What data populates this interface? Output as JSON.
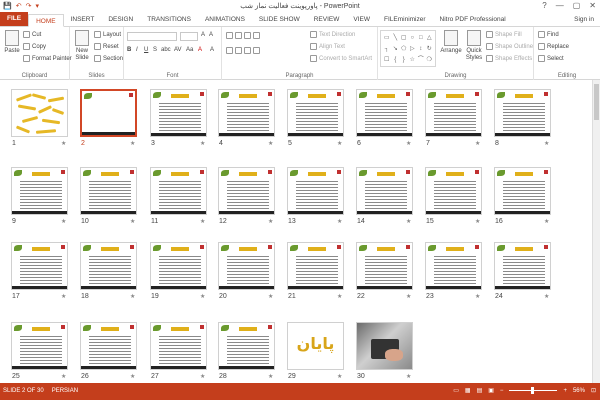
{
  "window": {
    "title": "پاورپوینت فعالیت نماز شب - PowerPoint",
    "controls": [
      "?",
      "—",
      "▢",
      "✕"
    ]
  },
  "quick_access": [
    "💾",
    "↶",
    "↷",
    "▾"
  ],
  "tabs": [
    {
      "label": "FILE"
    },
    {
      "label": "HOME"
    },
    {
      "label": "INSERT"
    },
    {
      "label": "DESIGN"
    },
    {
      "label": "TRANSITIONS"
    },
    {
      "label": "ANIMATIONS"
    },
    {
      "label": "SLIDE SHOW"
    },
    {
      "label": "REVIEW"
    },
    {
      "label": "VIEW"
    },
    {
      "label": "FILEminimizer"
    },
    {
      "label": "Nitro PDF Professional"
    }
  ],
  "signin": "Sign in",
  "ribbon": {
    "clipboard": {
      "paste": "Paste",
      "cut": "Cut",
      "copy": "Copy",
      "format_painter": "Format Painter",
      "label": "Clipboard"
    },
    "slides": {
      "new_slide": "New Slide",
      "layout": "Layout",
      "reset": "Reset",
      "section": "Section",
      "label": "Slides"
    },
    "font": {
      "bold": "B",
      "italic": "I",
      "underline": "U",
      "strike": "S",
      "shadow": "abc",
      "spacing": "AV",
      "case": "Aa",
      "color": "A",
      "grow": "A",
      "shrink": "A",
      "clear": "A",
      "label": "Font"
    },
    "paragraph": {
      "text_direction": "Text Direction",
      "align_text": "Align Text",
      "smartart": "Convert to SmartArt",
      "label": "Paragraph"
    },
    "drawing": {
      "arrange": "Arrange",
      "quick_styles": "Quick Styles",
      "shape_fill": "Shape Fill",
      "shape_outline": "Shape Outline",
      "shape_effects": "Shape Effects",
      "label": "Drawing",
      "shapes": [
        "▭",
        "╲",
        "▢",
        "○",
        "□",
        "△",
        "┐",
        "↘",
        "⬠",
        "▷",
        "↕",
        "↻",
        "☐",
        "{",
        "}",
        "☆",
        "⌒",
        "❍"
      ]
    },
    "editing": {
      "find": "Find",
      "replace": "Replace",
      "select": "Select",
      "label": "Editing"
    }
  },
  "slides": [
    {
      "num": "1",
      "kind": "sticks"
    },
    {
      "num": "2",
      "kind": "blank",
      "selected": true
    },
    {
      "num": "3",
      "kind": "text"
    },
    {
      "num": "4",
      "kind": "text"
    },
    {
      "num": "5",
      "kind": "text"
    },
    {
      "num": "6",
      "kind": "text"
    },
    {
      "num": "7",
      "kind": "text"
    },
    {
      "num": "8",
      "kind": "text"
    },
    {
      "num": "9",
      "kind": "text"
    },
    {
      "num": "10",
      "kind": "text"
    },
    {
      "num": "11",
      "kind": "text"
    },
    {
      "num": "12",
      "kind": "text"
    },
    {
      "num": "13",
      "kind": "text"
    },
    {
      "num": "14",
      "kind": "text"
    },
    {
      "num": "15",
      "kind": "text"
    },
    {
      "num": "16",
      "kind": "text"
    },
    {
      "num": "17",
      "kind": "text"
    },
    {
      "num": "18",
      "kind": "text"
    },
    {
      "num": "19",
      "kind": "text"
    },
    {
      "num": "20",
      "kind": "text"
    },
    {
      "num": "21",
      "kind": "text"
    },
    {
      "num": "22",
      "kind": "text"
    },
    {
      "num": "23",
      "kind": "text"
    },
    {
      "num": "24",
      "kind": "text"
    },
    {
      "num": "25",
      "kind": "text"
    },
    {
      "num": "26",
      "kind": "text"
    },
    {
      "num": "27",
      "kind": "text"
    },
    {
      "num": "28",
      "kind": "text"
    },
    {
      "num": "29",
      "kind": "end",
      "text": "پایان"
    },
    {
      "num": "30",
      "kind": "photo"
    }
  ],
  "status": {
    "slide_info": "SLIDE 2 OF 30",
    "language": "PERSIAN",
    "zoom": "56%"
  },
  "colors": {
    "accent": "#c43e1c",
    "selected_border": "#d24726",
    "title_bar": "#e0b01a"
  }
}
